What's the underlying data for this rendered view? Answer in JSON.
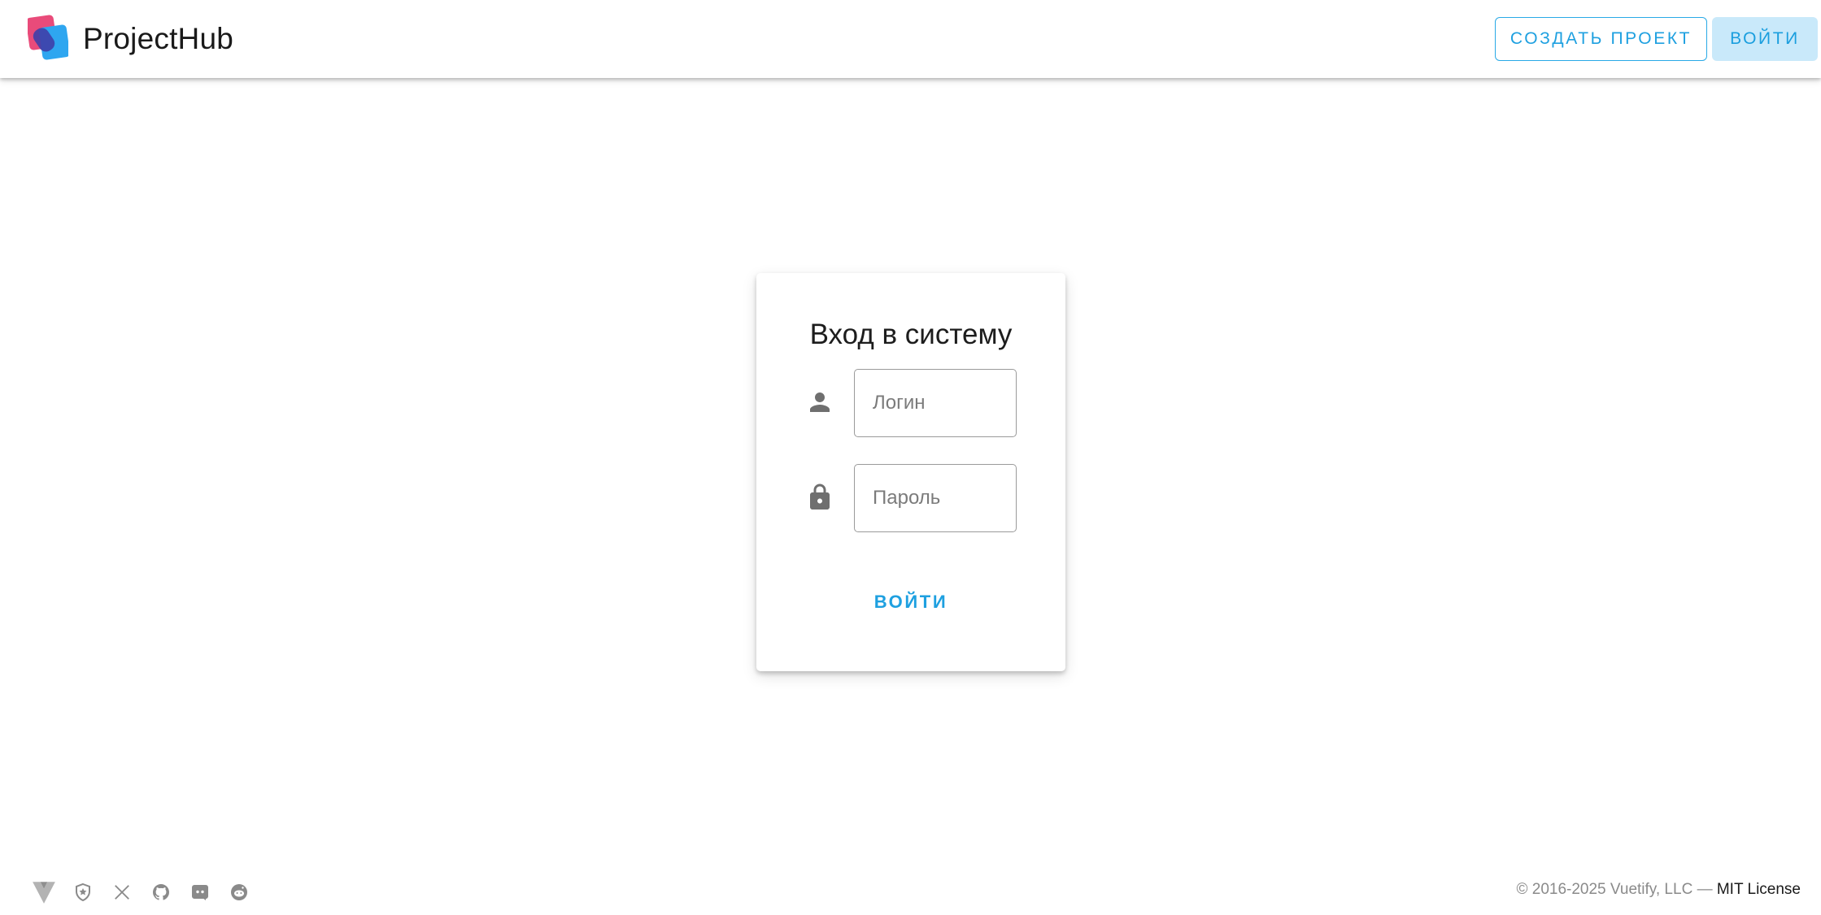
{
  "appbar": {
    "brand": "ProjectHub",
    "create_project_label": "СОЗДАТЬ ПРОЕКТ",
    "login_label": "ВОЙТИ"
  },
  "login_card": {
    "title": "Вход в систему",
    "login_field": {
      "placeholder": "Логин",
      "value": "",
      "icon": "account-icon"
    },
    "password_field": {
      "placeholder": "Пароль",
      "value": "",
      "icon": "lock-icon"
    },
    "submit_label": "ВОЙТИ"
  },
  "footer": {
    "icons": [
      "vuetify-logo-icon",
      "shield-icon",
      "x-twitter-icon",
      "github-icon",
      "discord-icon",
      "reddit-icon"
    ],
    "copyright_prefix": "© 2016-2025 Vuetify, LLC — ",
    "license_link": "MIT License"
  },
  "colors": {
    "accent": "#1ea0e0",
    "accent_tonal_bg": "#c9e9fa",
    "icon_gray": "#757575",
    "footer_text": "#8a8a8a"
  }
}
